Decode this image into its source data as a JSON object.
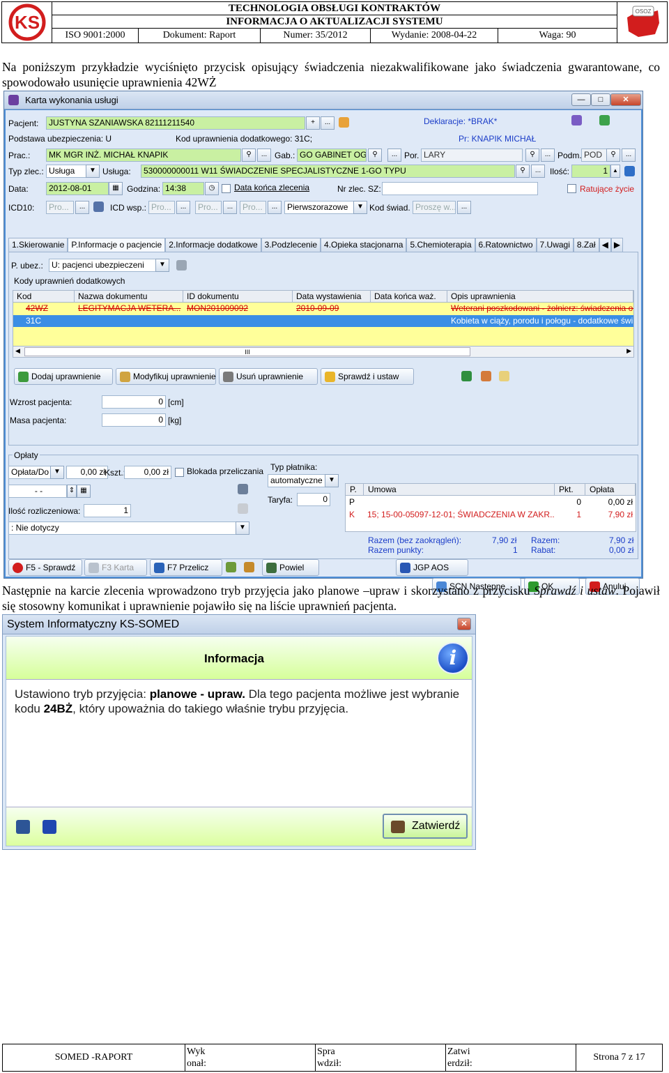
{
  "header": {
    "title": "TECHNOLOGIA OBSŁUGI KONTRAKTÓW",
    "subtitle": "INFORMACJA O AKTUALIZACJI SYSTEMU",
    "iso": "ISO 9001:2000",
    "dokument": "Dokument: Raport",
    "numer": "Numer: 35/2012",
    "wydanie": "Wydanie: 2008-04-22",
    "waga": "Waga: 90",
    "logo_left": "KS",
    "logo_right": "OSOZ"
  },
  "para1": "Na poniższym przykładzie wyciśnięto przycisk opisujący świadczenia niezakwalifikowane jako świadczenia gwarantowane, co spowodowało usunięcie uprawnienia 42WŻ",
  "para2_a": "Następnie na karcie zlecenia wprowadzono tryb przyjęcia jako planowe –upraw i skorzystano z przycisku ",
  "para2_i": "Sprawdź i ustaw",
  "para2_b": ". Pojawił się stosowny komunikat i uprawnienie pojawiło się na liście uprawnień pacjenta.",
  "karta": {
    "title": "Karta wykonania usługi",
    "btn_min": "—",
    "btn_max": "□",
    "btn_close": "✕",
    "pacjent_lbl": "Pacjent:",
    "pacjent_val": "JUSTYNA SZANIAWSKA 82111211540",
    "deklaracje": "Deklaracje: *BRAK*",
    "podstawa": "Podstawa ubezpieczenia: U",
    "kod_upr": "Kod uprawnienia dodatkowego: 31C;",
    "pr": "Pr: KNAPIK MICHAŁ",
    "prac_lbl": "Prac.:",
    "prac_val": "MK MGR INŻ. MICHAŁ KNAPIK",
    "gab_lbl": "Gab.:",
    "gab_val": "GO GABINET OGÓ",
    "por_lbl": "Por.",
    "por_val": "LARY",
    "podm_lbl": "Podm.",
    "podm_val": "POD",
    "typ_lbl": "Typ zlec.:",
    "typ_val": "Usługa",
    "usluga_lbl": "Usługa:",
    "usluga_val": "530000000011 W11 ŚWIADCZENIE SPECJALISTYCZNE 1-GO TYPU",
    "ilosc_lbl": "Ilość:",
    "ilosc_val": "1",
    "data_lbl": "Data:",
    "data_val": "2012-08-01",
    "godzina_lbl": "Godzina:",
    "godzina_val": "14:38",
    "data_konca": "Data końca zlecenia",
    "nrzlec": "Nr zlec. SZ:",
    "ratujace": "Ratujące życie",
    "icd_lbl": "ICD10:",
    "icd_ph": "Pro...",
    "icdwsp_lbl": "ICD wsp.:",
    "icdwsp_ph": "Pro...",
    "pro2": "Pro...",
    "pro3": "Pro...",
    "pierwszorazowe": "Pierwszorazowe",
    "kodswiad_lbl": "Kod świad.",
    "kodswiad_ph": "Proszę w...",
    "ellipsis": "...",
    "tabs": [
      "1.Skierowanie",
      "P.Informacje o pacjencie",
      "2.Informacje dodatkowe",
      "3.Podzlecenie",
      "4.Opieka stacjonarna",
      "5.Chemioterapia",
      "6.Ratownictwo",
      "7.Uwagi",
      "8.Zał"
    ],
    "pubez_lbl": "P. ubez.:",
    "pubez_val": "U: pacjenci ubezpieczeni",
    "kody_group": "Kody uprawnień dodatkowych",
    "grid_cols": [
      "Kod",
      "Nazwa dokumentu",
      "ID dokumentu",
      "Data wystawienia",
      "Data końca waż.",
      "Opis uprawnienia"
    ],
    "row1": [
      "42WZ",
      "LEGITYMACJA WETERA...",
      "MON201009092",
      "2010-09-09",
      "",
      "Weterani poszkodowani - żołnierz: świadczenia op"
    ],
    "row2": [
      "31C",
      "",
      "",
      "",
      "",
      "Kobieta w ciąży, porodu i połogu - dodatkowe świ"
    ],
    "scroll_mark": "III",
    "btn_dodaj": "Dodaj uprawnienie",
    "btn_modyfikuj": "Modyfikuj uprawnienie",
    "btn_usun": "Usuń uprawnienie",
    "btn_sprawdz": "Sprawdź i ustaw",
    "wzrost_lbl": "Wzrost pacjenta:",
    "wzrost_val": "0",
    "wzrost_unit": "[cm]",
    "masa_lbl": "Masa pacjenta:",
    "masa_val": "0",
    "masa_unit": "[kg]",
    "oplaty_group": "Opłaty",
    "oplata_val": "Opłata/Do",
    "oplata_zl": "0,00 zł",
    "kszt_lbl": "Kszt.:",
    "kszt_val": "0,00 zł",
    "blokada": "Blokada przeliczania",
    "date_empty": "-   -",
    "ilosc_rozl_lbl": "Ilość rozliczeniowa:",
    "ilosc_rozl_val": "1",
    "nie_dotyczy": ": Nie dotyczy",
    "typ_platnika_lbl": "Typ płatnika:",
    "typ_platnika_val": "automatyczne",
    "taryfa_lbl": "Taryfa:",
    "taryfa_val": "0",
    "ucols": [
      "P.",
      "Umowa",
      "Pkt.",
      "Opłata"
    ],
    "urow1": [
      "P",
      "",
      "0",
      "0,00 zł"
    ],
    "urow2": [
      "K",
      "15; 15-00-05097-12-01; ŚWIADCZENIA W ZAKR...",
      "1",
      "7,90 zł"
    ],
    "razem_bez": "Razem (bez zaokrągleń):",
    "razem_bez_val": "7,90 zł",
    "razem_pkt": "Razem punkty:",
    "razem_pkt_val": "1",
    "razem": "Razem:",
    "razem_val": "7,90 zł",
    "rabat": "Rabat:",
    "rabat_val": "0,00 zł",
    "btn_f5": "F5 - Sprawdź",
    "btn_f3": "F3 Karta",
    "btn_f7": "F7 Przelicz",
    "btn_powiel": "Powiel",
    "btn_jgp": "JGP AOS",
    "btn_scn": "SCN Następne",
    "btn_ok": "OK",
    "btn_anuluj": "Anuluj"
  },
  "info": {
    "title": "System Informatyczny KS-SOMED",
    "close": "✕",
    "heading": "Informacja",
    "badge": "i",
    "msg_a": "Ustawiono tryb przyjęcia: ",
    "msg_b": "planowe - upraw.",
    "msg_c": " Dla tego pacjenta możliwe jest wybranie kodu ",
    "msg_d": "24BŻ",
    "msg_e": ", który upoważnia do takiego właśnie trybu przyjęcia.",
    "btn": "Zatwierdź"
  },
  "footer": {
    "c1": "SOMED -RAPORT",
    "c2a": "Wyk",
    "c2b": "onał:",
    "c3a": "Spra",
    "c3b": "wdził:",
    "c4a": "Zatwi",
    "c4b": "erdził:",
    "c5": "Strona 7 z 17"
  },
  "colors": {
    "field_green": "#c9f0a2",
    "window_blue": "#4f8fd6",
    "grid_yellow": "#ffff9a",
    "selected_row": "#3b8ee5",
    "red_text": "#d21d1d",
    "blue_text": "#1a3cc8"
  }
}
